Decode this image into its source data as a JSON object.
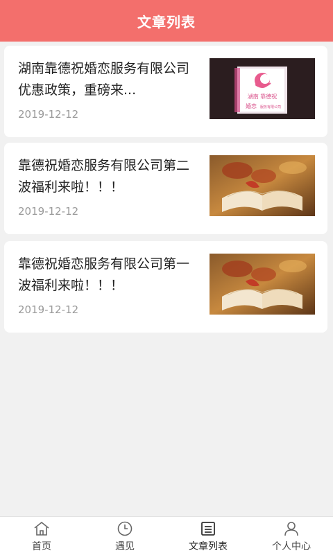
{
  "header": {
    "title": "文章列表"
  },
  "articles": [
    {
      "title": "湖南靠德祝婚恋服务有限公司优惠政策，重磅来...",
      "date": "2019-12-12",
      "thumb": "logo-image",
      "thumb_text": {
        "line1": "湖南 靠德祝",
        "line2": "婚恋",
        "line2_small": "服务有限公司"
      }
    },
    {
      "title": "靠德祝婚恋服务有限公司第二波福利来啦！！！",
      "date": "2019-12-12",
      "thumb": "book-image"
    },
    {
      "title": "靠德祝婚恋服务有限公司第一波福利来啦！！！",
      "date": "2019-12-12",
      "thumb": "book-image"
    }
  ],
  "tabbar": {
    "items": [
      {
        "label": "首页",
        "icon": "home-icon"
      },
      {
        "label": "遇见",
        "icon": "clock-icon"
      },
      {
        "label": "文章列表",
        "icon": "article-list-icon",
        "active": true
      },
      {
        "label": "个人中心",
        "icon": "user-icon"
      }
    ]
  },
  "colors": {
    "header_bg": "#f36f6c",
    "page_bg": "#f1f1f1",
    "logo_pink": "#e85b8e"
  }
}
